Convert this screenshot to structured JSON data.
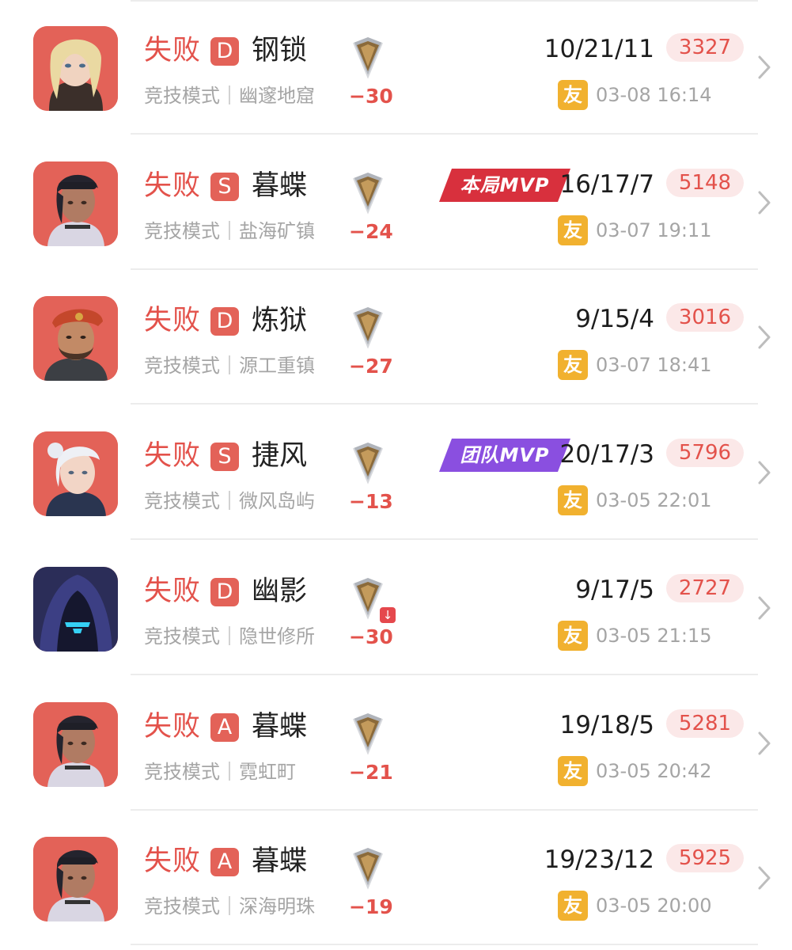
{
  "matches": [
    {
      "result": "失败",
      "grade": "D",
      "agent": "钢锁",
      "mode": "竞技模式｜幽邃地窟",
      "delta": "−30",
      "kda": "10/21/11",
      "score": "3327",
      "friend": "友",
      "time": "03-08 16:14",
      "mvp": "",
      "avatar": "blonde",
      "rank_down": false
    },
    {
      "result": "失败",
      "grade": "S",
      "agent": "暮蝶",
      "mode": "竞技模式｜盐海矿镇",
      "delta": "−24",
      "kda": "16/17/7",
      "score": "5148",
      "friend": "友",
      "time": "03-07 19:11",
      "mvp": "本局MVP",
      "mvp_color": "#d8303d",
      "avatar": "dark",
      "rank_down": false
    },
    {
      "result": "失败",
      "grade": "D",
      "agent": "炼狱",
      "mode": "竞技模式｜源工重镇",
      "delta": "−27",
      "kda": "9/15/4",
      "score": "3016",
      "friend": "友",
      "time": "03-07 18:41",
      "mvp": "",
      "avatar": "beret",
      "rank_down": false
    },
    {
      "result": "失败",
      "grade": "S",
      "agent": "捷风",
      "mode": "竞技模式｜微风岛屿",
      "delta": "−13",
      "kda": "20/17/3",
      "score": "5796",
      "friend": "友",
      "time": "03-05 22:01",
      "mvp": "团队MVP",
      "mvp_color": "#8a4fe0",
      "avatar": "white",
      "rank_down": false
    },
    {
      "result": "失败",
      "grade": "D",
      "agent": "幽影",
      "mode": "竞技模式｜隐世修所",
      "delta": "−30",
      "kda": "9/17/5",
      "score": "2727",
      "friend": "友",
      "time": "03-05 21:15",
      "mvp": "",
      "avatar": "hood",
      "rank_down": true
    },
    {
      "result": "失败",
      "grade": "A",
      "agent": "暮蝶",
      "mode": "竞技模式｜霓虹町",
      "delta": "−21",
      "kda": "19/18/5",
      "score": "5281",
      "friend": "友",
      "time": "03-05 20:42",
      "mvp": "",
      "avatar": "dark",
      "rank_down": false
    },
    {
      "result": "失败",
      "grade": "A",
      "agent": "暮蝶",
      "mode": "竞技模式｜深海明珠",
      "delta": "−19",
      "kda": "19/23/12",
      "score": "5925",
      "friend": "友",
      "time": "03-05 20:00",
      "mvp": "",
      "avatar": "dark",
      "rank_down": false
    }
  ],
  "icons": {
    "rank": "rank-badge-icon",
    "chevron": "chevron-right-icon",
    "rank_down": "rank-down-icon"
  },
  "colors": {
    "loss": "#e3524b",
    "grade_bg": "#e36258",
    "friend_bg": "#f1b12f",
    "score_bg": "#fbe8e8"
  }
}
